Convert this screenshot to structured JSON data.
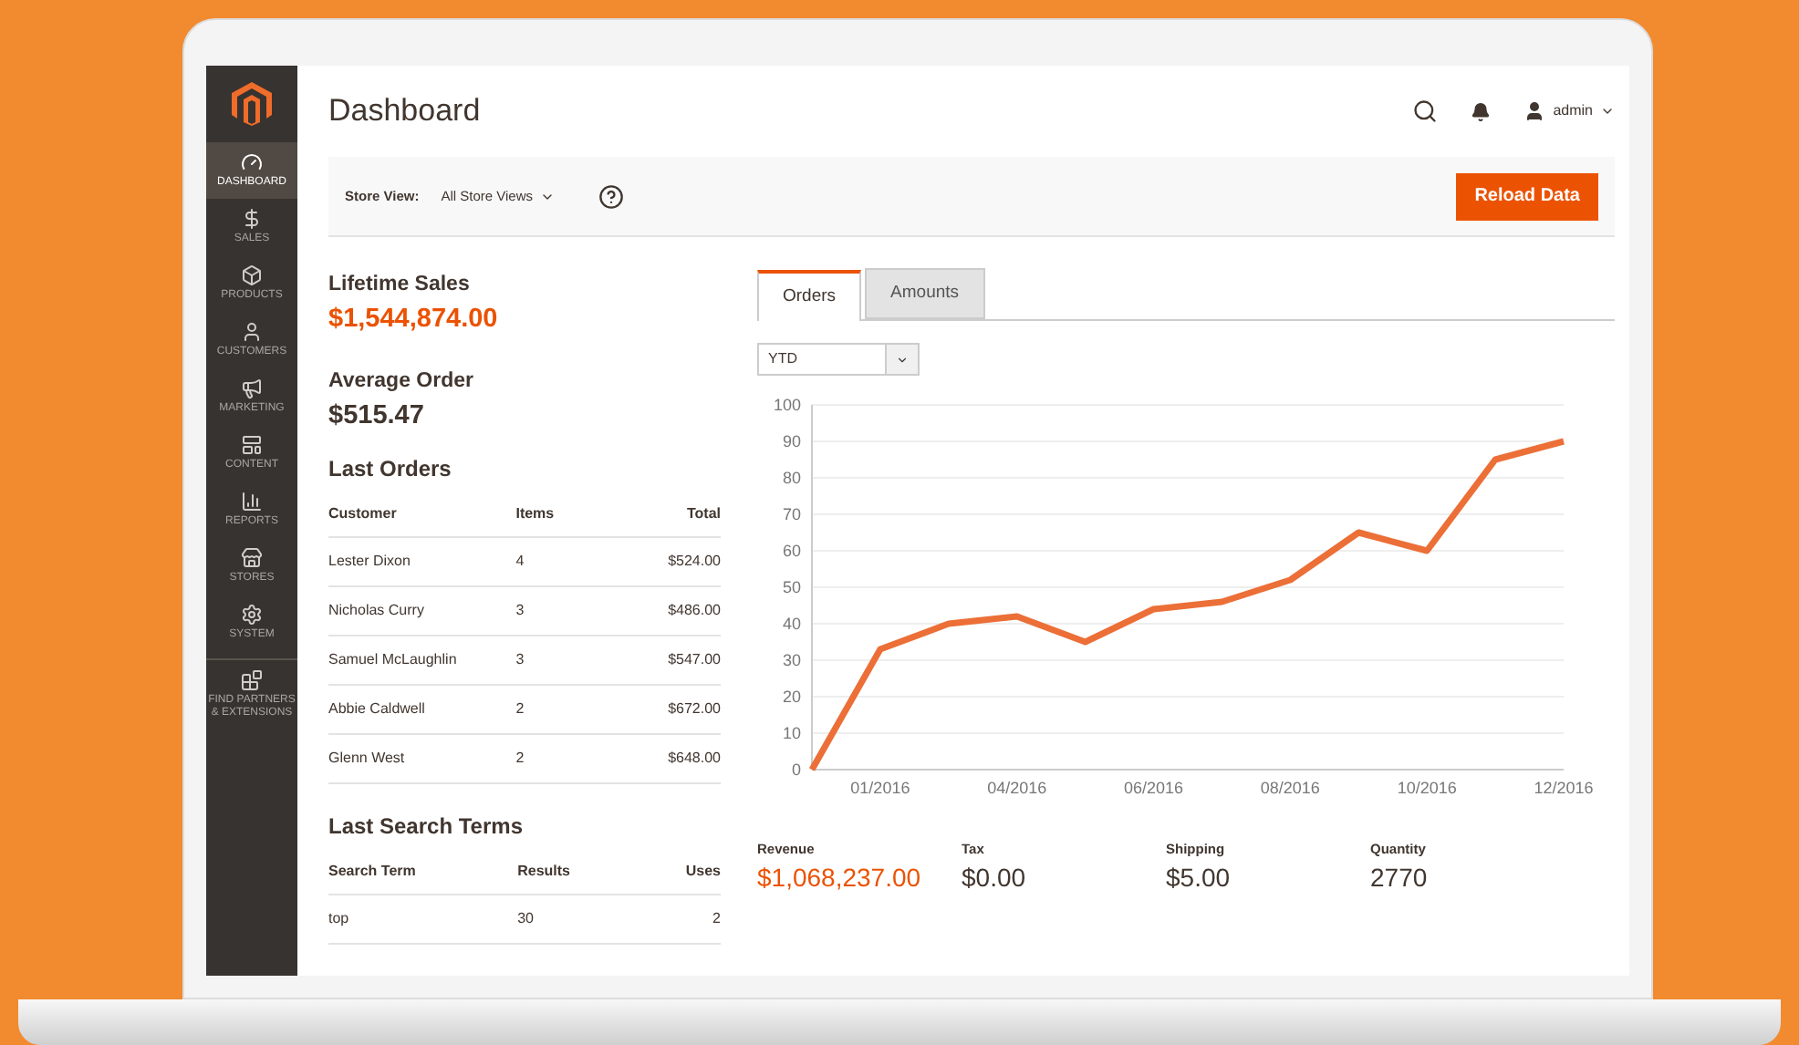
{
  "sidebar": {
    "items": [
      {
        "label": "DASHBOARD",
        "selected": true
      },
      {
        "label": "SALES",
        "selected": false
      },
      {
        "label": "PRODUCTS",
        "selected": false
      },
      {
        "label": "CUSTOMERS",
        "selected": false
      },
      {
        "label": "MARKETING",
        "selected": false
      },
      {
        "label": "CONTENT",
        "selected": false
      },
      {
        "label": "REPORTS",
        "selected": false
      },
      {
        "label": "STORES",
        "selected": false
      },
      {
        "label": "SYSTEM",
        "selected": false
      },
      {
        "label": "FIND PARTNERS & EXTENSIONS",
        "selected": false
      }
    ]
  },
  "header": {
    "title": "Dashboard",
    "user": "admin"
  },
  "toolbar": {
    "store_view_label": "Store View:",
    "store_view_value": "All Store Views",
    "reload_button": "Reload Data"
  },
  "lifetime_sales": {
    "label": "Lifetime Sales",
    "value": "$1,544,874.00"
  },
  "average_order": {
    "label": "Average Order",
    "value": "$515.47"
  },
  "last_orders": {
    "title": "Last Orders",
    "columns": [
      "Customer",
      "Items",
      "Total"
    ],
    "rows": [
      [
        "Lester Dixon",
        "4",
        "$524.00"
      ],
      [
        "Nicholas Curry",
        "3",
        "$486.00"
      ],
      [
        "Samuel McLaughlin",
        "3",
        "$547.00"
      ],
      [
        "Abbie Caldwell",
        "2",
        "$672.00"
      ],
      [
        "Glenn West",
        "2",
        "$648.00"
      ]
    ]
  },
  "last_search_terms": {
    "title": "Last Search Terms",
    "columns": [
      "Search Term",
      "Results",
      "Uses"
    ],
    "rows": [
      [
        "top",
        "30",
        "2"
      ]
    ]
  },
  "tabs": [
    {
      "label": "Orders",
      "selected": true
    },
    {
      "label": "Amounts",
      "selected": false
    }
  ],
  "period_select": {
    "value": "YTD"
  },
  "chart": {
    "chart_data": {
      "type": "line",
      "categories": [
        null,
        "01/2016",
        null,
        "04/2016",
        null,
        "06/2016",
        null,
        "08/2016",
        null,
        "10/2016",
        null,
        "12/2016"
      ],
      "series": [
        {
          "color": "#eb6f37",
          "values": [
            0,
            33,
            40,
            42,
            35,
            44,
            46,
            52,
            65,
            60,
            85,
            90
          ]
        }
      ],
      "ylim": [
        0,
        100
      ],
      "grid": true,
      "yticks": [
        0,
        10,
        20,
        30,
        40,
        50,
        60,
        70,
        80,
        90,
        100
      ]
    }
  },
  "totals": [
    {
      "label": "Revenue",
      "value": "$1,068,237.00",
      "highlight": true
    },
    {
      "label": "Tax",
      "value": "$0.00",
      "highlight": false
    },
    {
      "label": "Shipping",
      "value": "$5.00",
      "highlight": false
    },
    {
      "label": "Quantity",
      "value": "2770",
      "highlight": false
    }
  ]
}
